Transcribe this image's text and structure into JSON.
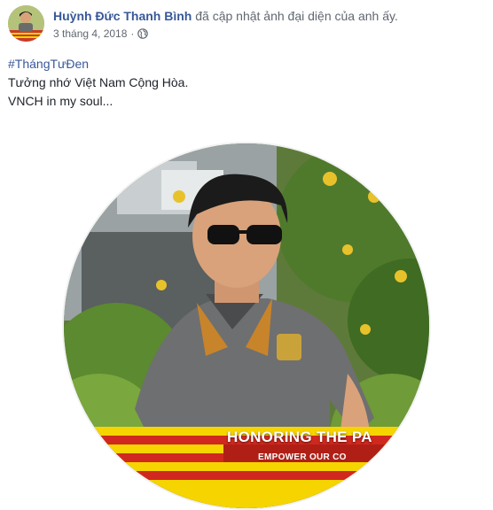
{
  "post": {
    "author": "Huỳnh Đức Thanh Bình",
    "action": "đã cập nhật ảnh đại diện của anh ấy.",
    "date": "3 tháng 4, 2018",
    "privacy_icon": "globe-icon",
    "hashtag": "#ThángTưĐen",
    "line1": "Tưởng nhớ Việt Nam Cộng Hòa.",
    "line2": "VNCH in my soul..."
  },
  "photo": {
    "banner_title": "HONORING THE PA",
    "banner_subtitle": "EMPOWER OUR CO"
  },
  "colors": {
    "link": "#385898",
    "flag_yellow": "#f5d400",
    "flag_red": "#d0281e"
  }
}
